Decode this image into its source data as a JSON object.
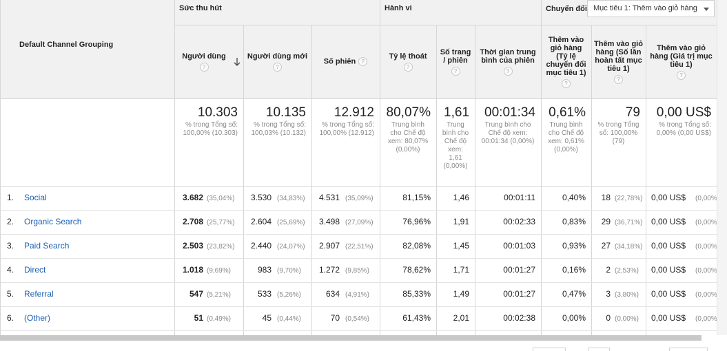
{
  "groups": {
    "dimension": "Default Channel Grouping",
    "acquisition": "Sức thu hút",
    "behavior": "Hành vi",
    "conversions": "Chuyển đổi"
  },
  "goal_select": {
    "value": "Mục tiêu 1: Thêm vào giỏ hàng"
  },
  "help_glyph": "?",
  "columns": [
    {
      "label": "Người dùng",
      "sorted": true
    },
    {
      "label": "Người dùng mới"
    },
    {
      "label": "Số phiên"
    },
    {
      "label": "Tỷ lệ thoát"
    },
    {
      "label": "Số trang / phiên"
    },
    {
      "label": "Thời gian trung bình của phiên"
    },
    {
      "label": "Thêm vào giỏ hàng (Tỷ lệ chuyển đổi mục tiêu 1)"
    },
    {
      "label": "Thêm vào giỏ hàng (Số lần hoàn tất mục tiêu 1)"
    },
    {
      "label": "Thêm vào giỏ hàng (Giá trị mục tiêu 1)"
    }
  ],
  "totals": [
    {
      "main": "10.303",
      "sub": "% trong Tổng số: 100,00% (10.303)"
    },
    {
      "main": "10.135",
      "sub": "% trong Tổng số: 100,03% (10.132)"
    },
    {
      "main": "12.912",
      "sub": "% trong Tổng số: 100,00% (12.912)"
    },
    {
      "main": "80,07%",
      "sub": "Trung bình cho Chế độ xem: 80,07% (0,00%)"
    },
    {
      "main": "1,61",
      "sub": "Trung bình cho Chế độ xem: 1,61 (0,00%)"
    },
    {
      "main": "00:01:34",
      "sub": "Trung bình cho Chế độ xem: 00:01:34 (0,00%)"
    },
    {
      "main": "0,61%",
      "sub": "Trung bình cho Chế độ xem: 0,61% (0,00%)"
    },
    {
      "main": "79",
      "sub": "% trong Tổng số: 100,00% (79)"
    },
    {
      "main": "0,00 US$",
      "sub": "% trong Tổng số: 0,00% (0,00 US$)"
    }
  ],
  "rows": [
    {
      "idx": "1.",
      "channel": "Social",
      "users": "3.682",
      "users_pct": "(35,04%)",
      "new_users": "3.530",
      "new_users_pct": "(34,83%)",
      "sessions": "4.531",
      "sessions_pct": "(35,09%)",
      "bounce": "81,15%",
      "pages": "1,46",
      "duration": "00:01:11",
      "conv_rate": "0,40%",
      "completions": "18",
      "completions_pct": "(22,78%)",
      "value": "0,00 US$",
      "value_pct": "(0,00%)"
    },
    {
      "idx": "2.",
      "channel": "Organic Search",
      "users": "2.708",
      "users_pct": "(25,77%)",
      "new_users": "2.604",
      "new_users_pct": "(25,69%)",
      "sessions": "3.498",
      "sessions_pct": "(27,09%)",
      "bounce": "76,96%",
      "pages": "1,91",
      "duration": "00:02:33",
      "conv_rate": "0,83%",
      "completions": "29",
      "completions_pct": "(36,71%)",
      "value": "0,00 US$",
      "value_pct": "(0,00%)"
    },
    {
      "idx": "3.",
      "channel": "Paid Search",
      "users": "2.503",
      "users_pct": "(23,82%)",
      "new_users": "2.440",
      "new_users_pct": "(24,07%)",
      "sessions": "2.907",
      "sessions_pct": "(22,51%)",
      "bounce": "82,08%",
      "pages": "1,45",
      "duration": "00:01:03",
      "conv_rate": "0,93%",
      "completions": "27",
      "completions_pct": "(34,18%)",
      "value": "0,00 US$",
      "value_pct": "(0,00%)"
    },
    {
      "idx": "4.",
      "channel": "Direct",
      "users": "1.018",
      "users_pct": "(9,69%)",
      "new_users": "983",
      "new_users_pct": "(9,70%)",
      "sessions": "1.272",
      "sessions_pct": "(9,85%)",
      "bounce": "78,62%",
      "pages": "1,71",
      "duration": "00:01:27",
      "conv_rate": "0,16%",
      "completions": "2",
      "completions_pct": "(2,53%)",
      "value": "0,00 US$",
      "value_pct": "(0,00%)"
    },
    {
      "idx": "5.",
      "channel": "Referral",
      "users": "547",
      "users_pct": "(5,21%)",
      "new_users": "533",
      "new_users_pct": "(5,26%)",
      "sessions": "634",
      "sessions_pct": "(4,91%)",
      "bounce": "85,33%",
      "pages": "1,49",
      "duration": "00:01:27",
      "conv_rate": "0,47%",
      "completions": "3",
      "completions_pct": "(3,80%)",
      "value": "0,00 US$",
      "value_pct": "(0,00%)"
    },
    {
      "idx": "6.",
      "channel": "(Other)",
      "users": "51",
      "users_pct": "(0,49%)",
      "new_users": "45",
      "new_users_pct": "(0,44%)",
      "sessions": "70",
      "sessions_pct": "(0,54%)",
      "bounce": "61,43%",
      "pages": "2,01",
      "duration": "00:02:38",
      "conv_rate": "0,00%",
      "completions": "0",
      "completions_pct": "(0,00%)",
      "value": "0,00 US$",
      "value_pct": "(0,00%)"
    }
  ]
}
